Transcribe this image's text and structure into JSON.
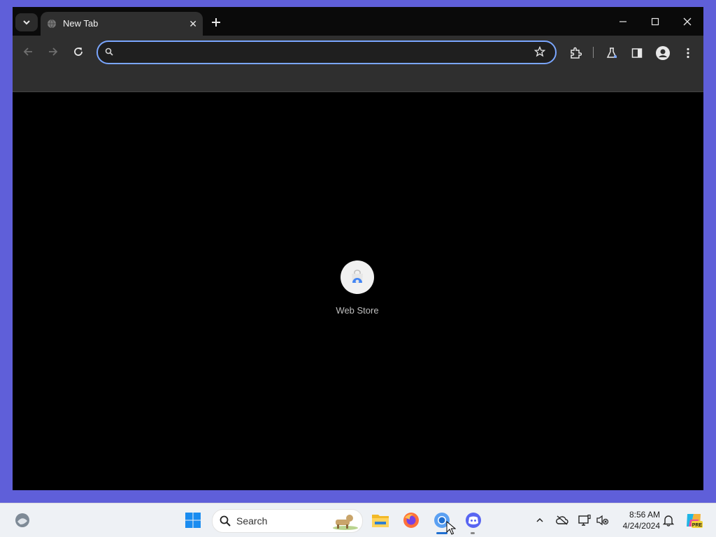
{
  "browser": {
    "tab": {
      "title": "New Tab"
    },
    "omnibox": {
      "value": "",
      "placeholder": ""
    },
    "colors": {
      "frame": "#0a0a0a",
      "toolbar": "#2f2f2f",
      "focus_ring": "#7aa6ff"
    }
  },
  "content": {
    "shortcuts": [
      {
        "label": "Web Store",
        "icon": "chrome-web-store-icon"
      }
    ]
  },
  "taskbar": {
    "search_label": "Search",
    "apps": [
      "widgets-icon",
      "start-icon",
      "file-explorer-icon",
      "firefox-icon",
      "chrome-icon",
      "discord-icon"
    ],
    "tray": [
      "chevron-up-icon",
      "onedrive-offline-icon",
      "display-icon",
      "volume-muted-icon",
      "notification-bell-icon",
      "copilot-icon"
    ],
    "clock": {
      "time": "8:56 AM",
      "date": "4/24/2024"
    },
    "copilot_badge": "PRE"
  }
}
